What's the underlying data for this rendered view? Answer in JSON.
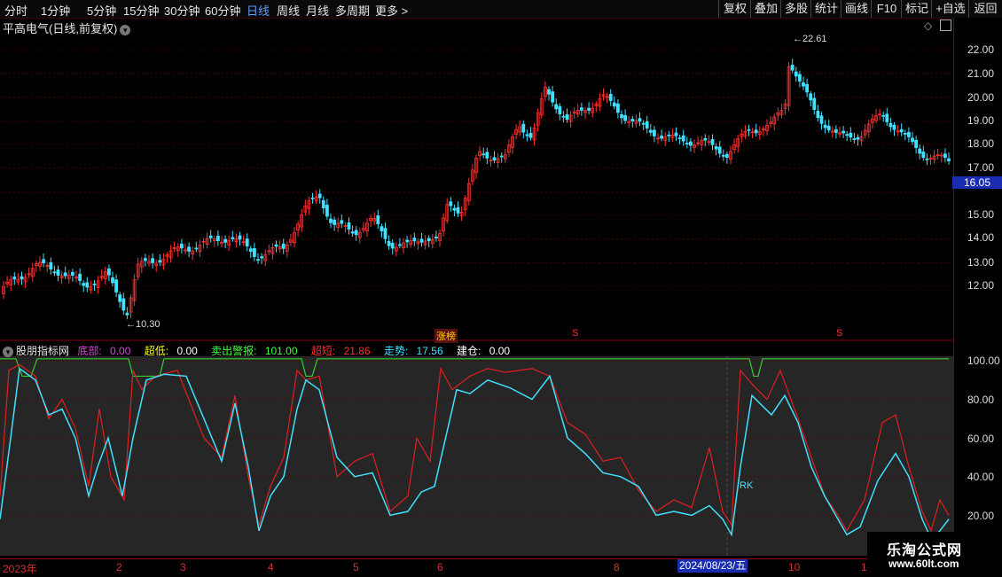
{
  "toolbar": {
    "periods": [
      "分时",
      "1分钟",
      "5分钟",
      "15分钟",
      "30分钟",
      "60分钟",
      "日线",
      "周线",
      "月线",
      "多周期",
      "更多 >"
    ],
    "active_period": "日线",
    "buttons": [
      "复权",
      "叠加",
      "多股",
      "统计",
      "画线",
      "F10",
      "标记",
      "+自选",
      "返回"
    ]
  },
  "chart_title": "平高电气(日线,前复权)",
  "price_axis": [
    "22.00",
    "21.00",
    "20.00",
    "19.00",
    "18.00",
    "17.00",
    "16.00",
    "15.00",
    "14.00",
    "13.00",
    "12.00"
  ],
  "current_price": "16.05",
  "high_label": "22.61",
  "low_label": "10.30",
  "markers": {
    "zhangbang": "涨榜",
    "s": "S"
  },
  "indicator": {
    "name": "股朋指标网",
    "items": [
      {
        "label": "底部:",
        "value": "0.00",
        "color": "#e040e0"
      },
      {
        "label": "超低:",
        "value": "0.00",
        "color": "#ffff00"
      },
      {
        "label": "卖出警报:",
        "value": "101.00",
        "color": "#40ff40"
      },
      {
        "label": "超短:",
        "value": "21.86",
        "color": "#ff3030"
      },
      {
        "label": "走势:",
        "value": "17.56",
        "color": "#40e0ff"
      },
      {
        "label": "建仓:",
        "value": "0.00",
        "color": "#ffffff"
      }
    ],
    "axis": [
      "100.00",
      "80.00",
      "60.00",
      "40.00",
      "20.00"
    ],
    "rk_label": "RK"
  },
  "x_axis": {
    "labels": [
      "2023年",
      "2",
      "3",
      "4",
      "5",
      "6",
      "8",
      "10",
      "1"
    ],
    "selected_date": "2024/08/23/五"
  },
  "watermark": {
    "name": "乐淘公式网",
    "url": "www.60lt.com"
  },
  "colors": {
    "up": "#ff3030",
    "down": "#40e0ff",
    "grid": "#5a0000",
    "ind_bg": "#262626"
  }
}
